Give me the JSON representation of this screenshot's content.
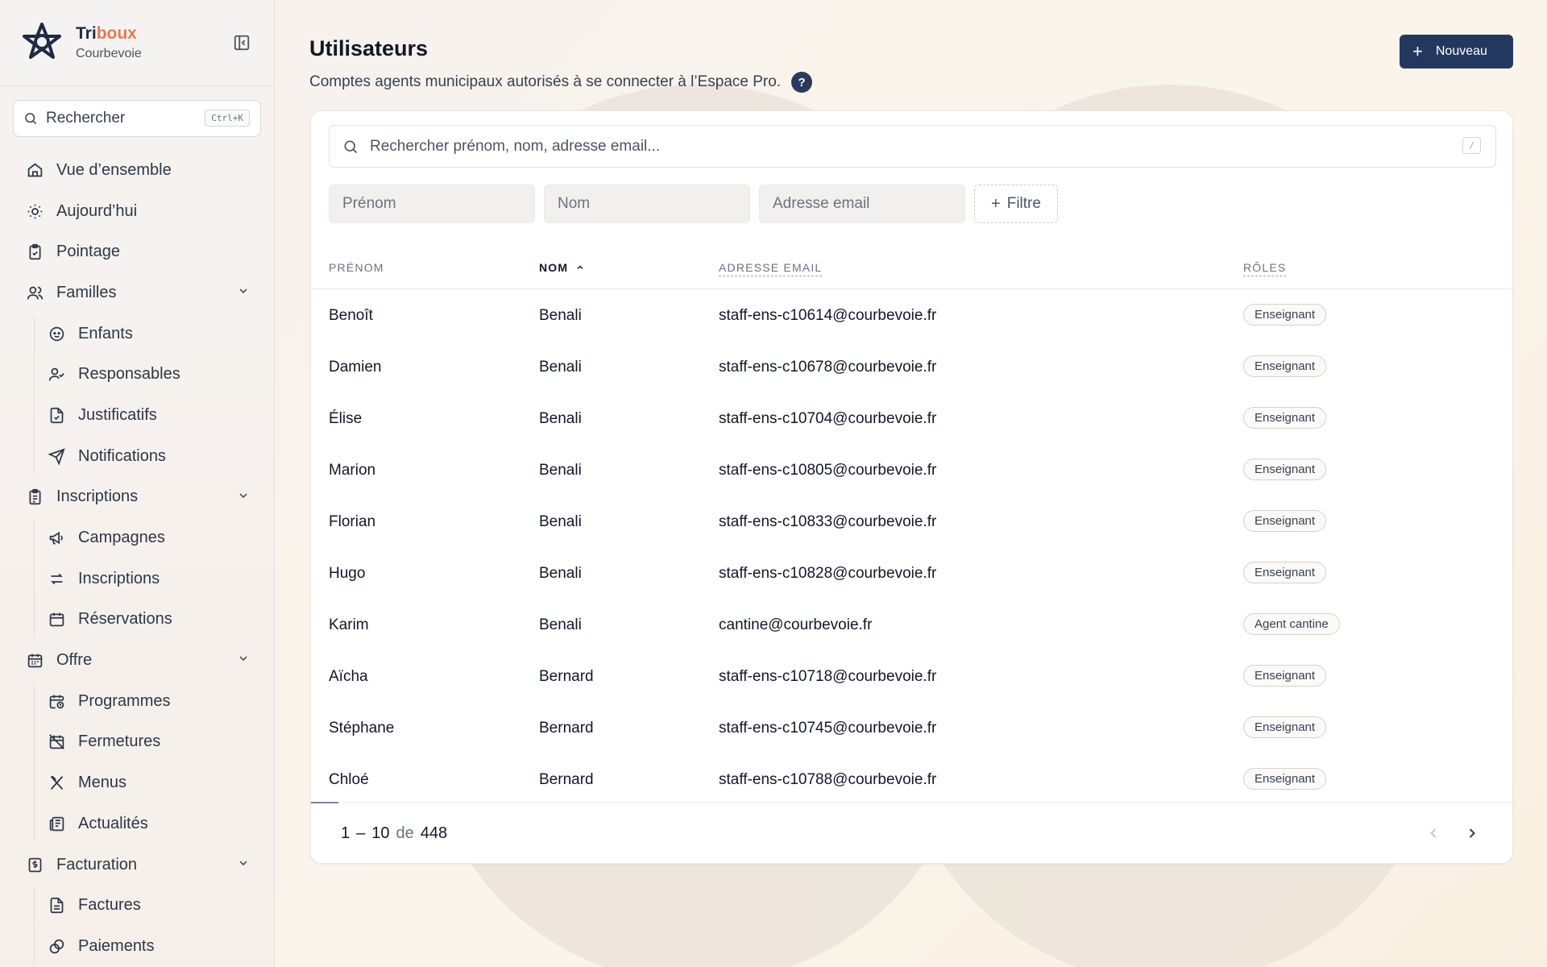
{
  "brand": {
    "name_part1": "Tri",
    "name_part2": "boux",
    "subtitle": "Courbevoie"
  },
  "sidebar": {
    "search_label": "Rechercher",
    "search_shortcut": "Ctrl+K",
    "items": [
      {
        "label": "Vue d’ensemble",
        "icon": "home-icon"
      },
      {
        "label": "Aujourd’hui",
        "icon": "sun-icon"
      },
      {
        "label": "Pointage",
        "icon": "clipboard-check-icon"
      },
      {
        "label": "Familles",
        "icon": "users-icon"
      },
      {
        "label": "Enfants",
        "icon": "baby-icon"
      },
      {
        "label": "Responsables",
        "icon": "user-check-icon"
      },
      {
        "label": "Justificatifs",
        "icon": "file-check-icon"
      },
      {
        "label": "Notifications",
        "icon": "send-icon"
      },
      {
        "label": "Inscriptions",
        "icon": "clipboard-list-icon"
      },
      {
        "label": "Campagnes",
        "icon": "megaphone-icon"
      },
      {
        "label": "Inscriptions",
        "icon": "arrows-exchange-icon"
      },
      {
        "label": "Réservations",
        "icon": "calendar-icon"
      },
      {
        "label": "Offre",
        "icon": "calendar-days-icon"
      },
      {
        "label": "Programmes",
        "icon": "calendar-clock-icon"
      },
      {
        "label": "Fermetures",
        "icon": "calendar-off-icon"
      },
      {
        "label": "Menus",
        "icon": "utensils-icon"
      },
      {
        "label": "Actualités",
        "icon": "newspaper-icon"
      },
      {
        "label": "Facturation",
        "icon": "receipt-icon"
      },
      {
        "label": "Factures",
        "icon": "file-text-icon"
      },
      {
        "label": "Paiements",
        "icon": "coins-icon"
      }
    ]
  },
  "page": {
    "title": "Utilisateurs",
    "subtitle": "Comptes agents municipaux autorisés à se connecter à l’Espace Pro.",
    "help": "?",
    "new_button": "Nouveau"
  },
  "search": {
    "placeholder": "Rechercher prénom, nom, adresse email...",
    "shortcut": "/"
  },
  "filters": {
    "first_name": "Prénom",
    "last_name": "Nom",
    "email": "Adresse email",
    "add_filter": "Filtre"
  },
  "table": {
    "columns": [
      "PRÉNOM",
      "NOM",
      "ADRESSE EMAIL",
      "RÔLES"
    ],
    "sorted_column": "NOM",
    "rows": [
      {
        "first": "Benoît",
        "last": "Benali",
        "email": "staff-ens-c10614@courbevoie.fr",
        "role": "Enseignant"
      },
      {
        "first": "Damien",
        "last": "Benali",
        "email": "staff-ens-c10678@courbevoie.fr",
        "role": "Enseignant"
      },
      {
        "first": "Élise",
        "last": "Benali",
        "email": "staff-ens-c10704@courbevoie.fr",
        "role": "Enseignant"
      },
      {
        "first": "Marion",
        "last": "Benali",
        "email": "staff-ens-c10805@courbevoie.fr",
        "role": "Enseignant"
      },
      {
        "first": "Florian",
        "last": "Benali",
        "email": "staff-ens-c10833@courbevoie.fr",
        "role": "Enseignant"
      },
      {
        "first": "Hugo",
        "last": "Benali",
        "email": "staff-ens-c10828@courbevoie.fr",
        "role": "Enseignant"
      },
      {
        "first": "Karim",
        "last": "Benali",
        "email": "cantine@courbevoie.fr",
        "role": "Agent cantine"
      },
      {
        "first": "Aïcha",
        "last": "Bernard",
        "email": "staff-ens-c10718@courbevoie.fr",
        "role": "Enseignant"
      },
      {
        "first": "Stéphane",
        "last": "Bernard",
        "email": "staff-ens-c10745@courbevoie.fr",
        "role": "Enseignant"
      },
      {
        "first": "Chloé",
        "last": "Bernard",
        "email": "staff-ens-c10788@courbevoie.fr",
        "role": "Enseignant"
      }
    ]
  },
  "pagination": {
    "from": "1",
    "dash": "–",
    "to": "10",
    "of_label": "de",
    "total": "448"
  },
  "colors": {
    "primary": "#24385f",
    "accent": "#e07a4f",
    "help_bg": "#2b3a5c"
  }
}
